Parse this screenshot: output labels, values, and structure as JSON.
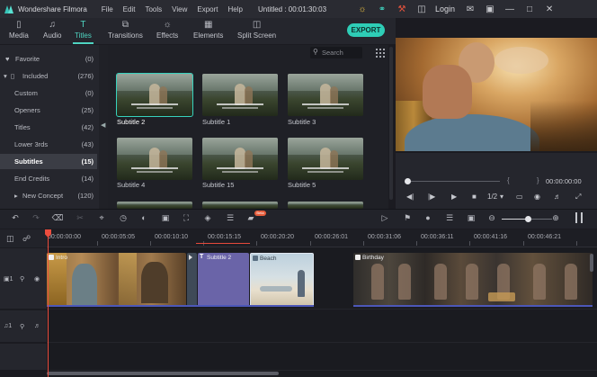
{
  "app": {
    "name": "Wondershare Filmora",
    "menu": [
      "File",
      "Edit",
      "Tools",
      "View",
      "Export",
      "Help"
    ],
    "document_title": "Untitled : 00:01:30:03",
    "login_label": "Login"
  },
  "tools": {
    "tabs": [
      {
        "label": "Media",
        "icon": "folder-icon"
      },
      {
        "label": "Audio",
        "icon": "music-note-icon"
      },
      {
        "label": "Titles",
        "icon": "text-icon"
      },
      {
        "label": "Transitions",
        "icon": "transitions-icon"
      },
      {
        "label": "Effects",
        "icon": "effects-icon"
      },
      {
        "label": "Elements",
        "icon": "elements-icon"
      },
      {
        "label": "Split Screen",
        "icon": "split-screen-icon"
      }
    ],
    "active_tab": "Titles",
    "export_label": "EXPORT"
  },
  "categories": [
    {
      "label": "Favorite",
      "count": "(0)"
    },
    {
      "label": "Included",
      "count": "(276)"
    },
    {
      "label": "Custom",
      "count": "(0)"
    },
    {
      "label": "Openers",
      "count": "(25)"
    },
    {
      "label": "Titles",
      "count": "(42)"
    },
    {
      "label": "Lower 3rds",
      "count": "(43)"
    },
    {
      "label": "Subtitles",
      "count": "(15)"
    },
    {
      "label": "End Credits",
      "count": "(14)"
    },
    {
      "label": "New Concept",
      "count": "(120)"
    }
  ],
  "active_category": "Subtitles",
  "search": {
    "placeholder": "Search"
  },
  "thumbnails": [
    {
      "label": "Subtitle 2",
      "selected": true
    },
    {
      "label": "Subtitle 1",
      "selected": false
    },
    {
      "label": "Subtitle 3",
      "selected": false
    },
    {
      "label": "Subtitle 4",
      "selected": false
    },
    {
      "label": "Subtitle 15",
      "selected": false
    },
    {
      "label": "Subtitle 5",
      "selected": false
    }
  ],
  "preview": {
    "timecode": "00:00:00:00",
    "playback_speed": "1/2",
    "progress": 0
  },
  "timeline": {
    "ruler": [
      "00:00:00:00",
      "00:00:05:05",
      "00:00:10:10",
      "00:00:15:15",
      "00:00:20:20",
      "00:00:26:01",
      "00:00:31:06",
      "00:00:36:11",
      "00:00:41:16",
      "00:00:46:21"
    ],
    "badge_label": "Beta",
    "clips": {
      "video1": "Intro",
      "subtitle": "Subtitle 2",
      "beach": "Beach",
      "birthday": "Birthday"
    }
  },
  "colors": {
    "accent": "#4fd4c1",
    "playhead": "#ec4d3e",
    "subtitle_clip": "#6a64a8"
  }
}
